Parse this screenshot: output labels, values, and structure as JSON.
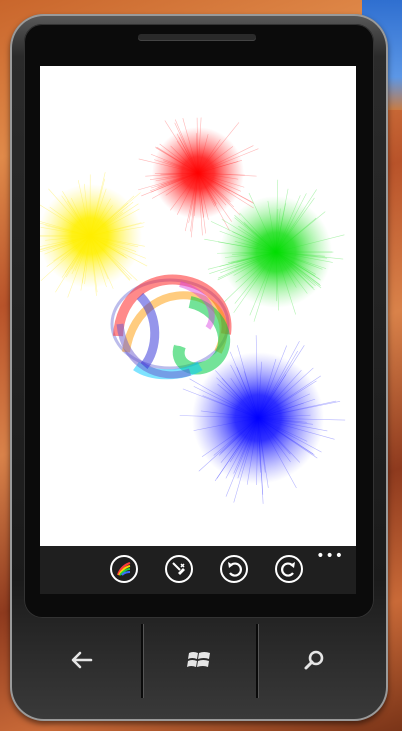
{
  "app_bar": {
    "buttons": [
      {
        "name": "color-picker-button",
        "icon": "color-palette-icon"
      },
      {
        "name": "clear-button",
        "icon": "eraser-icon"
      },
      {
        "name": "undo-button",
        "icon": "undo-icon"
      },
      {
        "name": "redo-button",
        "icon": "redo-icon"
      }
    ],
    "more_label": "•••"
  },
  "canvas": {
    "strokes": [
      {
        "name": "red-splat",
        "color": "#ff0000"
      },
      {
        "name": "yellow-splat",
        "color": "#ffee00"
      },
      {
        "name": "green-splat",
        "color": "#00dd00"
      },
      {
        "name": "blue-splat",
        "color": "#0000ff"
      },
      {
        "name": "rainbow-swirl",
        "color": "multicolor"
      }
    ]
  },
  "hardware_buttons": [
    {
      "name": "back-button",
      "icon": "back-arrow-icon"
    },
    {
      "name": "start-button",
      "icon": "windows-logo-icon"
    },
    {
      "name": "search-button",
      "icon": "search-icon"
    }
  ]
}
